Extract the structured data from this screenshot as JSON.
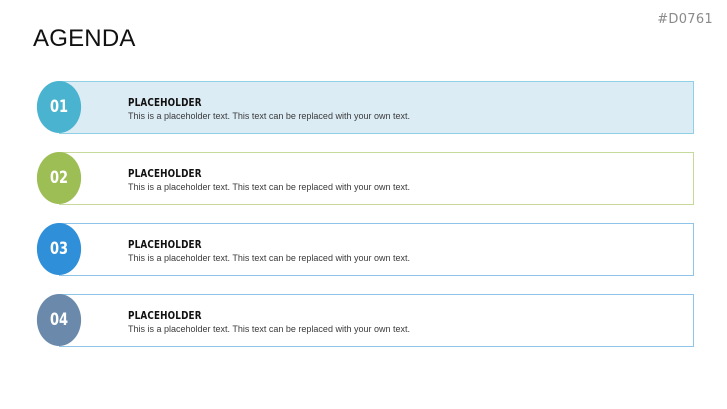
{
  "slide": {
    "id_label": "#D0761",
    "title": "AGENDA"
  },
  "items": [
    {
      "number": "01",
      "heading": "PLACEHOLDER",
      "text": "This is a placeholder text. This text can be replaced with your own text.",
      "accent": "#4ab3cf",
      "border": "#8fd0e4",
      "fill": "#dcecf5"
    },
    {
      "number": "02",
      "heading": "PLACEHOLDER",
      "text": "This is a placeholder text. This text can be replaced with your own text.",
      "accent": "#9dbd55",
      "border": "#c6d99b",
      "fill": "#ffffff"
    },
    {
      "number": "03",
      "heading": "PLACEHOLDER",
      "text": "This is a placeholder text. This text can be replaced with your own text.",
      "accent": "#2f8fd8",
      "border": "#8fc4e8",
      "fill": "#ffffff"
    },
    {
      "number": "04",
      "heading": "PLACEHOLDER",
      "text": "This is a placeholder text. This text can be replaced with your own text.",
      "accent": "#6a89ab",
      "border": "#8fc4e8",
      "fill": "#ffffff"
    }
  ]
}
